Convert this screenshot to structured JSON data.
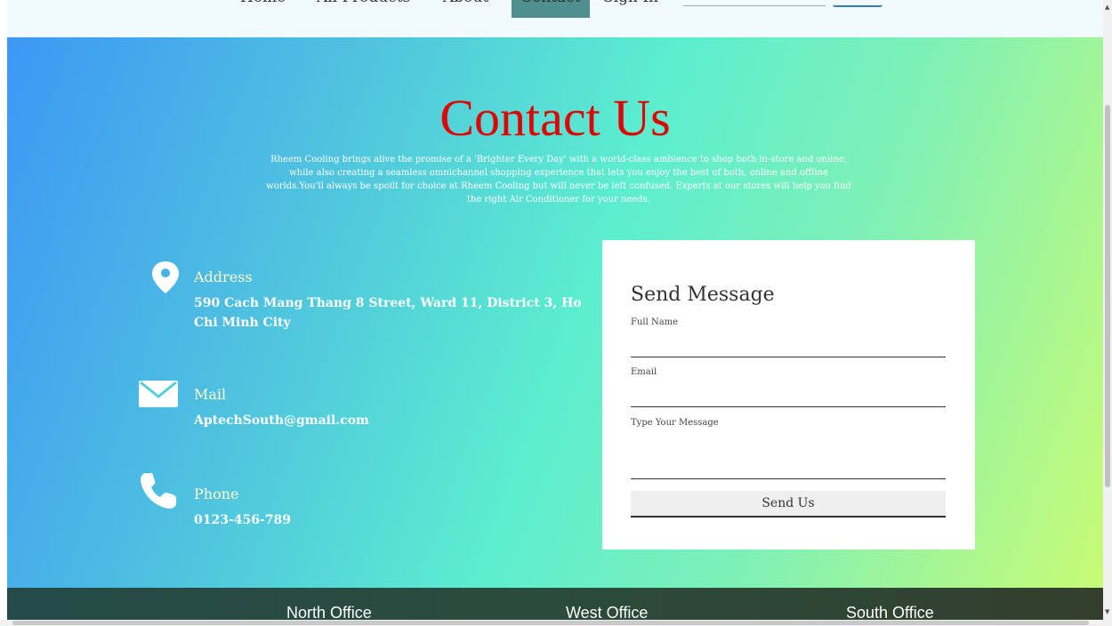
{
  "nav": {
    "items": [
      "Home",
      "All Products",
      "About",
      "Contact",
      "Sign In"
    ],
    "active": "Contact"
  },
  "hero": {
    "title": "Contact Us",
    "intro_lines": [
      "Rheem Cooling brings alive the promise of a 'Brighter Every Day' with a world-class ambience to shop both in-store and online,",
      "while also creating a seamless omnichannel shopping experience that lets you enjoy the best of both, online and offline",
      "worlds.You'll always be spoilt for choice at Rheem Cooling but will never be left confused. Experts at our stores will help you find",
      "the right Air Conditioner for your needs."
    ]
  },
  "contact": {
    "address": {
      "label": "Address",
      "value": "590 Cach Mang Thang 8 Street, Ward 11, District 3, Ho Chi Minh City",
      "icon": "location-pin-icon"
    },
    "mail": {
      "label": "Mail",
      "value": "AptechSouth@gmail.com",
      "icon": "envelope-icon"
    },
    "phone": {
      "label": "Phone",
      "value": "0123-456-789",
      "icon": "phone-icon"
    }
  },
  "form": {
    "title": "Send Message",
    "full_name_label": "Full Name",
    "full_name_value": "",
    "email_label": "Email",
    "email_value": "",
    "message_label": "Type Your Message",
    "message_value": "",
    "submit_label": "Send Us"
  },
  "footer": {
    "offices": [
      "North Office",
      "West Office",
      "South Office"
    ]
  },
  "colors": {
    "title": "#e20000",
    "label": "#fff7c9",
    "gradient_start": "#3d97f5",
    "gradient_end": "#c8fb75",
    "footer": "#244b49"
  }
}
